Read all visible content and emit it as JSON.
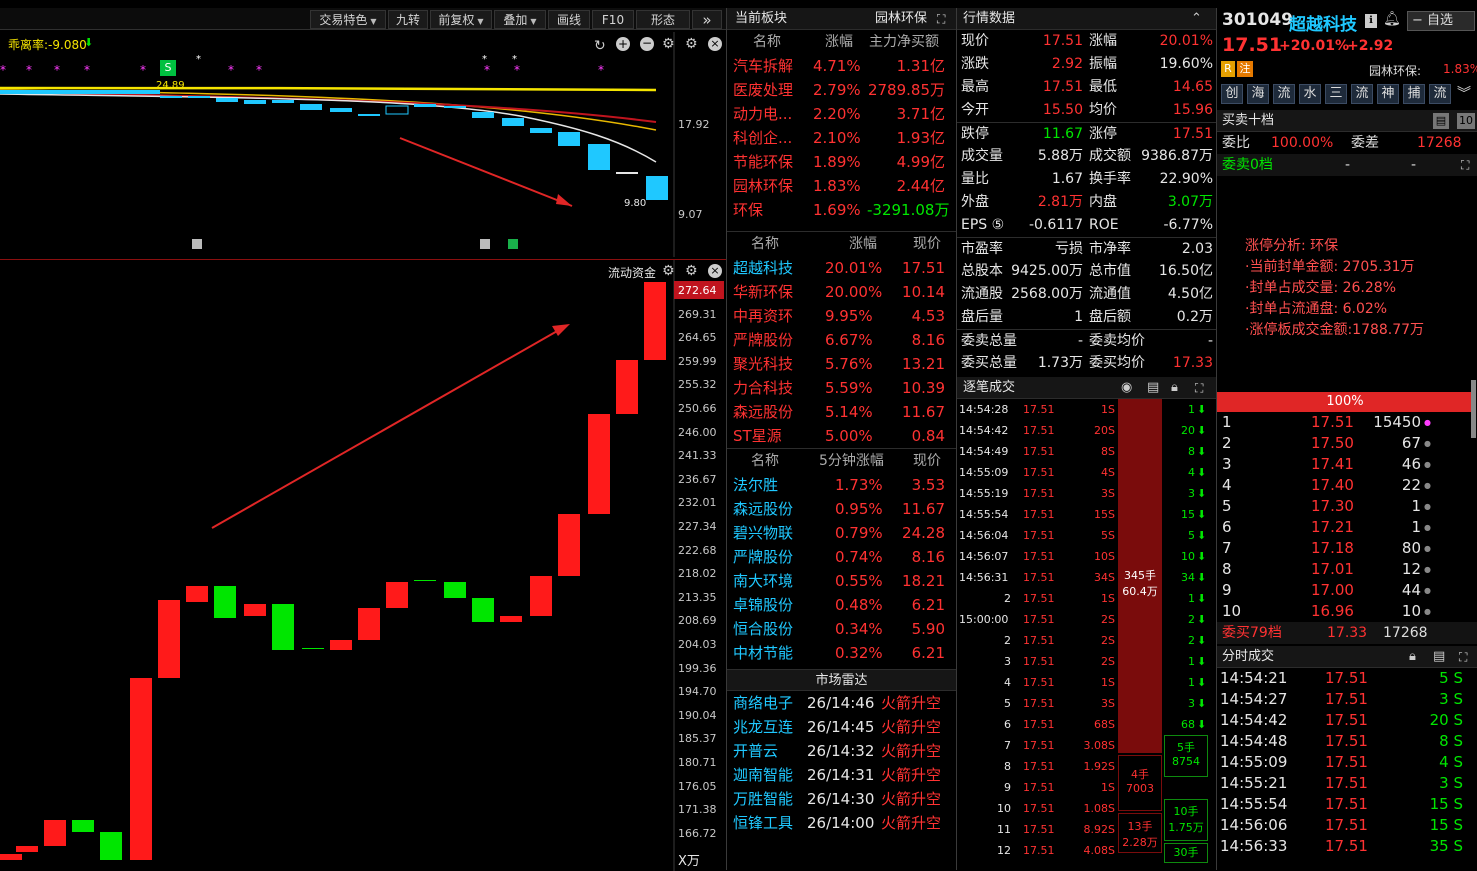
{
  "toolbar": {
    "items": [
      "交易特色",
      "九转",
      "前复权",
      "叠加",
      "画线",
      "F10",
      "形态"
    ],
    "more": "»"
  },
  "k1": {
    "indicator": "乖离率:-9.080",
    "ma_label": "24.89",
    "price_high": "17.92",
    "price_low": "9.07",
    "last_low": "9.80",
    "marker": "S"
  },
  "k2": {
    "title": "流动资金",
    "unit": "X万",
    "y_ticks": [
      "272.64",
      "269.31",
      "264.65",
      "259.99",
      "255.32",
      "250.66",
      "246.00",
      "241.33",
      "236.67",
      "232.01",
      "227.34",
      "222.68",
      "218.02",
      "213.35",
      "208.69",
      "204.03",
      "199.36",
      "194.70",
      "190.04",
      "185.37",
      "180.71",
      "176.05",
      "171.38",
      "166.72"
    ]
  },
  "sector": {
    "title": "当前板块",
    "current": "园林环保",
    "headers": [
      "名称",
      "涨幅",
      "主力净买额"
    ],
    "rows": [
      [
        "汽车拆解",
        "4.71%",
        "1.31亿"
      ],
      [
        "医废处理",
        "2.79%",
        "2789.85万"
      ],
      [
        "动力电...",
        "2.20%",
        "3.71亿"
      ],
      [
        "科创企...",
        "2.10%",
        "1.93亿"
      ],
      [
        "节能环保",
        "1.89%",
        "4.99亿"
      ],
      [
        "园林环保",
        "1.83%",
        "2.44亿"
      ],
      [
        "环保",
        "1.69%",
        "-3291.08万"
      ]
    ]
  },
  "gainers": {
    "headers": [
      "名称",
      "涨幅",
      "现价"
    ],
    "rows": [
      [
        "超越科技",
        "20.01%",
        "17.51"
      ],
      [
        "华新环保",
        "20.00%",
        "10.14"
      ],
      [
        "中再资环",
        "9.95%",
        "4.53"
      ],
      [
        "严牌股份",
        "6.67%",
        "8.16"
      ],
      [
        "聚光科技",
        "5.76%",
        "13.21"
      ],
      [
        "力合科技",
        "5.59%",
        "10.39"
      ],
      [
        "森远股份",
        "5.14%",
        "11.67"
      ],
      [
        "ST星源",
        "5.00%",
        "0.84"
      ]
    ]
  },
  "speed": {
    "headers": [
      "名称",
      "5分钟涨幅",
      "现价"
    ],
    "rows": [
      [
        "法尔胜",
        "1.73%",
        "3.53"
      ],
      [
        "森远股份",
        "0.95%",
        "11.67"
      ],
      [
        "碧兴物联",
        "0.79%",
        "24.28"
      ],
      [
        "严牌股份",
        "0.74%",
        "8.16"
      ],
      [
        "南大环境",
        "0.55%",
        "18.21"
      ],
      [
        "卓锦股份",
        "0.48%",
        "6.21"
      ],
      [
        "恒合股份",
        "0.34%",
        "5.90"
      ],
      [
        "中材节能",
        "0.32%",
        "6.21"
      ]
    ]
  },
  "radar": {
    "title": "市场雷达",
    "rows": [
      [
        "商络电子",
        "26/14:46",
        "火箭升空"
      ],
      [
        "兆龙互连",
        "26/14:45",
        "火箭升空"
      ],
      [
        "开普云",
        "26/14:32",
        "火箭升空"
      ],
      [
        "迦南智能",
        "26/14:31",
        "火箭升空"
      ],
      [
        "万胜智能",
        "26/14:30",
        "火箭升空"
      ],
      [
        "恒锋工具",
        "26/14:00",
        "火箭升空"
      ]
    ]
  },
  "quote": {
    "title": "行情数据",
    "rows": [
      [
        "现价",
        "17.51",
        "涨幅",
        "20.01%"
      ],
      [
        "涨跌",
        "2.92",
        "振幅",
        "19.60%"
      ],
      [
        "最高",
        "17.51",
        "最低",
        "14.65"
      ],
      [
        "今开",
        "15.50",
        "均价",
        "15.96"
      ],
      [
        "跌停",
        "11.67",
        "涨停",
        "17.51"
      ],
      [
        "成交量",
        "5.88万",
        "成交额",
        "9386.87万"
      ],
      [
        "量比",
        "1.67",
        "换手率",
        "22.90%"
      ],
      [
        "外盘",
        "2.81万",
        "内盘",
        "3.07万"
      ],
      [
        "EPS ⑤",
        "-0.6117",
        "ROE",
        "-6.77%"
      ],
      [
        "市盈率",
        "亏损",
        "市净率",
        "2.03"
      ],
      [
        "总股本",
        "9425.00万",
        "总市值",
        "16.50亿"
      ],
      [
        "流通股",
        "2568.00万",
        "流通值",
        "4.50亿"
      ],
      [
        "盘后量",
        "1",
        "盘后额",
        "0.2万"
      ],
      [
        "委卖总量",
        "-",
        "委卖均价",
        "-"
      ],
      [
        "委买总量",
        "1.73万",
        "委买均价",
        "17.33"
      ]
    ]
  },
  "ticks": {
    "title": "逐笔成交",
    "rows": [
      [
        "14:54:28",
        "17.51",
        "1S"
      ],
      [
        "14:54:42",
        "17.51",
        "20S"
      ],
      [
        "14:54:49",
        "17.51",
        "8S"
      ],
      [
        "14:55:09",
        "17.51",
        "4S"
      ],
      [
        "14:55:19",
        "17.51",
        "3S"
      ],
      [
        "14:55:54",
        "17.51",
        "15S"
      ],
      [
        "14:56:04",
        "17.51",
        "5S"
      ],
      [
        "14:56:07",
        "17.51",
        "10S"
      ],
      [
        "14:56:31",
        "17.51",
        "34S"
      ],
      [
        "2",
        "17.51",
        "1S"
      ],
      [
        "15:00:00",
        "17.51",
        "2S"
      ],
      [
        "2",
        "17.51",
        "2S"
      ],
      [
        "3",
        "17.51",
        "2S"
      ],
      [
        "4",
        "17.51",
        "1S"
      ],
      [
        "5",
        "17.51",
        "3S"
      ],
      [
        "6",
        "17.51",
        "68S"
      ],
      [
        "7",
        "17.51",
        "3.08S"
      ],
      [
        "8",
        "17.51",
        "1.92S"
      ],
      [
        "9",
        "17.51",
        "1S"
      ],
      [
        "10",
        "17.51",
        "1.08S"
      ],
      [
        "11",
        "17.51",
        "8.92S"
      ],
      [
        "12",
        "17.51",
        "4.08S"
      ]
    ],
    "agg": [
      "1",
      "20",
      "8",
      "4",
      "3",
      "15",
      "5",
      "10",
      "34",
      "1",
      "2",
      "2",
      "1",
      "1",
      "3",
      "68"
    ],
    "block1": [
      "345手",
      "60.4万"
    ],
    "block2": [
      "4手",
      "7003"
    ],
    "block3": [
      "13手",
      "2.28万"
    ],
    "block4": [
      "5手",
      "8754"
    ],
    "block5": [
      "10手",
      "1.75万"
    ],
    "block6": [
      "30手"
    ]
  },
  "stock": {
    "code": "301049",
    "name": "超越科技",
    "price": "17.51",
    "pct": "+20.01%",
    "chg": "+2.92",
    "fav": "自选",
    "tags": [
      "R",
      "注"
    ],
    "sector": "园林环保:",
    "sector_pct": "1.83%",
    "quick": [
      "创",
      "海",
      "流",
      "水",
      "三",
      "流",
      "神",
      "捕",
      "流"
    ]
  },
  "orderbook": {
    "title": "买卖十档",
    "weibi_label": "委比",
    "weibi": "100.00%",
    "weicha_label": "委差",
    "weicha": "17268",
    "sell": "委卖0档",
    "dash1": "-",
    "dash2": "-",
    "analysis": [
      "涨停分析: 环保",
      "·当前封单金额: 2705.31万",
      "·封单占成交量: 26.28%",
      "·封单占流通盘: 6.02%",
      "·涨停板成交金额:1788.77万"
    ],
    "bar": "100%",
    "levels": [
      [
        "1",
        "17.51",
        "15450"
      ],
      [
        "2",
        "17.50",
        "67"
      ],
      [
        "3",
        "17.41",
        "46"
      ],
      [
        "4",
        "17.40",
        "22"
      ],
      [
        "5",
        "17.30",
        "1"
      ],
      [
        "6",
        "17.21",
        "1"
      ],
      [
        "7",
        "17.18",
        "80"
      ],
      [
        "8",
        "17.01",
        "12"
      ],
      [
        "9",
        "17.00",
        "44"
      ],
      [
        "10",
        "16.96",
        "10"
      ]
    ],
    "buy_sum": [
      "委买79档",
      "17.33",
      "17268"
    ]
  },
  "minute": {
    "title": "分时成交",
    "rows": [
      [
        "14:54:21",
        "17.51",
        "5 S"
      ],
      [
        "14:54:27",
        "17.51",
        "3 S"
      ],
      [
        "14:54:42",
        "17.51",
        "20 S"
      ],
      [
        "14:54:48",
        "17.51",
        "8 S"
      ],
      [
        "14:55:09",
        "17.51",
        "4 S"
      ],
      [
        "14:55:21",
        "17.51",
        "3 S"
      ],
      [
        "14:55:54",
        "17.51",
        "15 S"
      ],
      [
        "14:56:06",
        "17.51",
        "15 S"
      ],
      [
        "14:56:33",
        "17.51",
        "35 S"
      ]
    ]
  },
  "colors": {
    "up": "#ff3232",
    "down": "#00e600",
    "cyan": "#1fc8ff",
    "bg": "#000000"
  }
}
